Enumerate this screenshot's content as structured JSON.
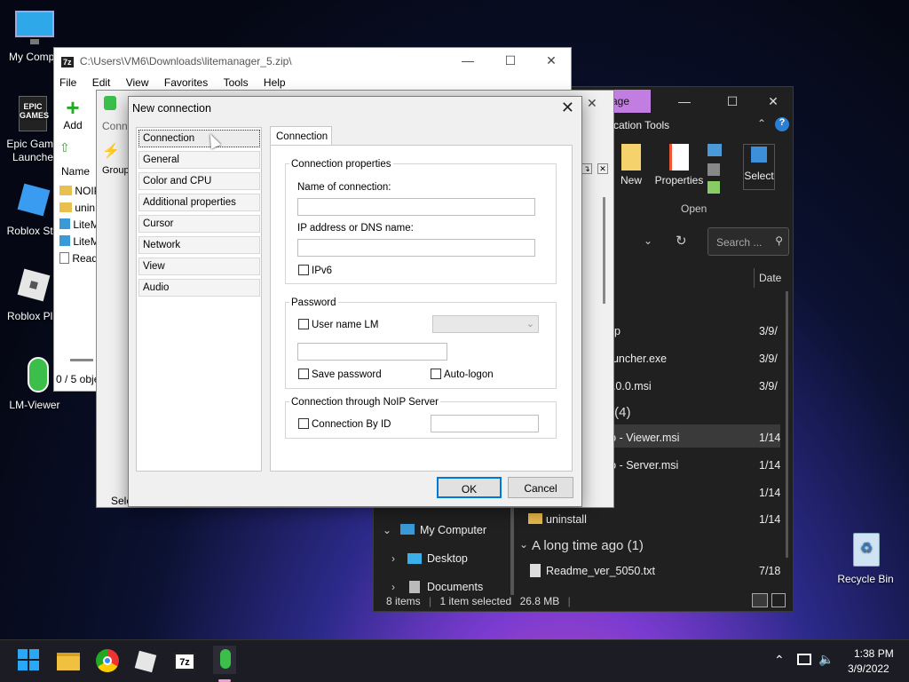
{
  "desktop_icons": [
    {
      "label": "My Compu"
    },
    {
      "label": "Epic Game\nLaunche"
    },
    {
      "label": "Roblox Stu"
    },
    {
      "label": "Roblox Pla"
    },
    {
      "label": "LM-Viewer"
    },
    {
      "label": "Recycle Bin"
    }
  ],
  "explorer": {
    "ribbon_tab": "age",
    "ribbon_group": "cation Tools",
    "buttons": {
      "new": "New",
      "properties": "Properties",
      "select": "Select",
      "open_group": "Open"
    },
    "search_placeholder": "Search ...",
    "column_date": "Date",
    "files": [
      {
        "name": "zip",
        "date": "3/9/"
      },
      {
        "name": "auncher.exe",
        "date": "3/9/"
      },
      {
        "name": "3.0.0.msi",
        "date": "3/9/"
      },
      {
        "name": "ro - Viewer.msi",
        "date": "1/14"
      },
      {
        "name": "ro - Server.msi",
        "date": "1/14"
      },
      {
        "name": "r)",
        "date": "1/14"
      },
      {
        "name": "uninstall",
        "date": "1/14"
      },
      {
        "name": "Readme_ver_5050.txt",
        "date": "7/18"
      }
    ],
    "group_earlier": "r (4)",
    "group_long_ago": "A long time ago (1)",
    "nav": {
      "my_computer": "My Computer",
      "desktop": "Desktop",
      "documents": "Documents"
    },
    "status": {
      "items": "8 items",
      "selected": "1 item selected",
      "size": "26.8 MB"
    }
  },
  "zip_window": {
    "title": "C:\\Users\\VM6\\Downloads\\litemanager_5.zip\\",
    "menu": [
      "File",
      "Edit",
      "View",
      "Favorites",
      "Tools",
      "Help"
    ],
    "add_label": "Add",
    "col_name": "Name",
    "rows": [
      "NOIP",
      "unin",
      "LiteM",
      "LiteM",
      "Read"
    ],
    "status": "0 / 5 obje"
  },
  "lm_window": {
    "conn_label": "Conn",
    "groups_label": "Groups",
    "select_label": "Sele"
  },
  "dialog": {
    "title": "New connection",
    "categories": [
      "Connection",
      "General",
      "Color and CPU",
      "Additional properties",
      "Cursor",
      "Network",
      "View",
      "Audio"
    ],
    "tab": "Connection",
    "conn_props": {
      "legend": "Connection properties",
      "name_label": "Name of connection:",
      "name_value": "",
      "ip_label": "IP address or DNS name:",
      "ip_value": "",
      "ipv6": "IPv6"
    },
    "password": {
      "legend": "Password",
      "user_name_lm": "User name LM",
      "save_password": "Save password",
      "auto_logon": "Auto-logon"
    },
    "noip": {
      "legend": "Connection through NoIP Server",
      "by_id": "Connection By ID"
    },
    "ok": "OK",
    "cancel": "Cancel"
  },
  "taskbar": {
    "time": "1:38 PM",
    "date": "3/9/2022"
  }
}
